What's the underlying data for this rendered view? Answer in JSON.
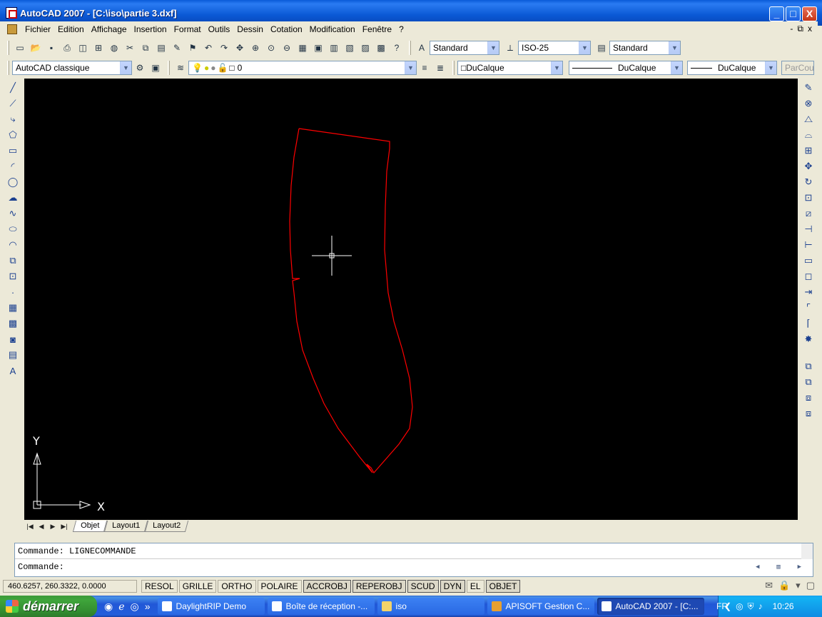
{
  "window": {
    "title": "AutoCAD 2007 - [C:\\iso\\partie 3.dxf]",
    "buttons": [
      "_",
      "□",
      "X"
    ]
  },
  "menu": {
    "items": [
      "Fichier",
      "Edition",
      "Affichage",
      "Insertion",
      "Format",
      "Outils",
      "Dessin",
      "Cotation",
      "Modification",
      "Fenêtre",
      "?"
    ],
    "mdi_buttons": [
      "-",
      "⧉",
      "x"
    ]
  },
  "toolbar1": {
    "text_style": "Standard",
    "dim_style": "ISO-25",
    "table_style": "Standard"
  },
  "toolbar2": {
    "workspace": "AutoCAD classique",
    "layer": "0",
    "color": "DuCalque",
    "linetype": "DuCalque",
    "lineweight": "DuCalque",
    "plot_style": "ParCoul"
  },
  "canvas": {
    "background": "#000000",
    "polyline_color": "#ff0000",
    "ucs_x_label": "X",
    "ucs_y_label": "Y"
  },
  "layout_tabs": [
    "Objet",
    "Layout1",
    "Layout2"
  ],
  "command": {
    "history": "Commande: LIGNECOMMANDE",
    "prompt": "Commande:"
  },
  "status": {
    "coordinates": "460.6257, 260.3322, 0.0000",
    "toggles": [
      {
        "label": "RESOL",
        "on": false
      },
      {
        "label": "GRILLE",
        "on": false
      },
      {
        "label": "ORTHO",
        "on": false
      },
      {
        "label": "POLAIRE",
        "on": false
      },
      {
        "label": "ACCROBJ",
        "on": true
      },
      {
        "label": "REPEROBJ",
        "on": true
      },
      {
        "label": "SCUD",
        "on": true
      },
      {
        "label": "DYN",
        "on": true
      },
      {
        "label": "EL",
        "on": false
      },
      {
        "label": "OBJET",
        "on": true
      }
    ]
  },
  "taskbar": {
    "start_label": "démarrer",
    "tasks": [
      "DaylightRIP Demo",
      "Boîte de réception -...",
      "iso",
      "APISOFT Gestion C...",
      "AutoCAD 2007 - [C:..."
    ],
    "language": "FR",
    "clock": "10:26"
  }
}
